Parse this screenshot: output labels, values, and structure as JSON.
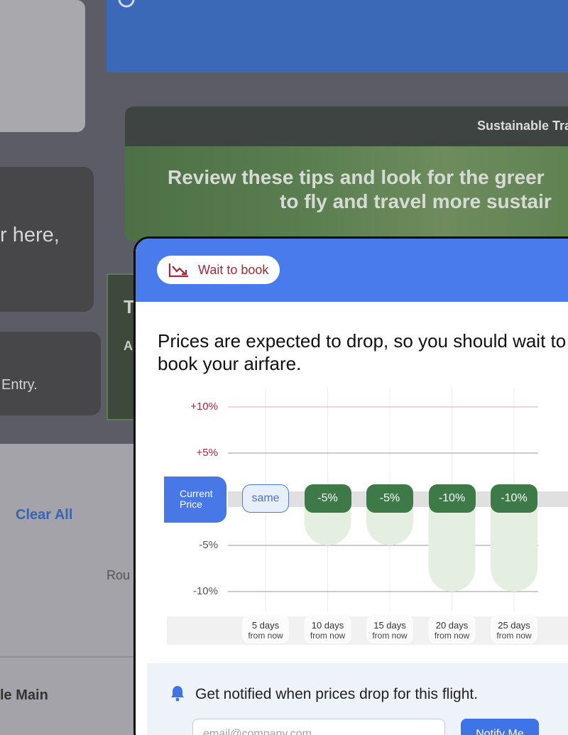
{
  "background": {
    "card_text_1": "r here,",
    "card_text_2": "Entry.",
    "green_box_letter_t": "T",
    "green_box_letter_a": "A",
    "sustainable_header": "Sustainable Tra",
    "sustainable_line1": "Review these tips and look for the greer",
    "sustainable_line2": "to fly and travel more sustair",
    "clear_all": "Clear All",
    "rou_text": "Rou",
    "main_text": "le Main"
  },
  "modal": {
    "badge_label": "Wait to book",
    "badge_icon": "trend-down-icon",
    "headline": "Prices are expected to drop, so you should wait to book your airfare.",
    "current_price_line1": "Current",
    "current_price_line2": "Price",
    "notify_text": "Get notified when prices drop for this flight.",
    "notify_icon": "bell-icon",
    "email_placeholder": "email@company.com",
    "notify_button": "Notify Me"
  },
  "colors": {
    "header_blue": "#4a7bec",
    "badge_red": "#a3283a",
    "pill_green": "#3e7a48",
    "bar_green_light": "#e5efe1"
  },
  "chart_data": {
    "type": "bar",
    "categories": [
      {
        "line1": "5 days",
        "line2": "from now"
      },
      {
        "line1": "10 days",
        "line2": "from now"
      },
      {
        "line1": "15 days",
        "line2": "from now"
      },
      {
        "line1": "20 days",
        "line2": "from now"
      },
      {
        "line1": "25 days",
        "line2": "from now"
      }
    ],
    "values": [
      0,
      -5,
      -5,
      -10,
      -10
    ],
    "labels": [
      "same",
      "-5%",
      "-5%",
      "-10%",
      "-10%"
    ],
    "y_ticks": [
      {
        "value": 10,
        "label": "+10%"
      },
      {
        "value": 5,
        "label": "+5%"
      },
      {
        "value": -5,
        "label": "-5%"
      },
      {
        "value": -10,
        "label": "-10%"
      }
    ],
    "ylim": [
      -10,
      10
    ],
    "grid": true
  }
}
